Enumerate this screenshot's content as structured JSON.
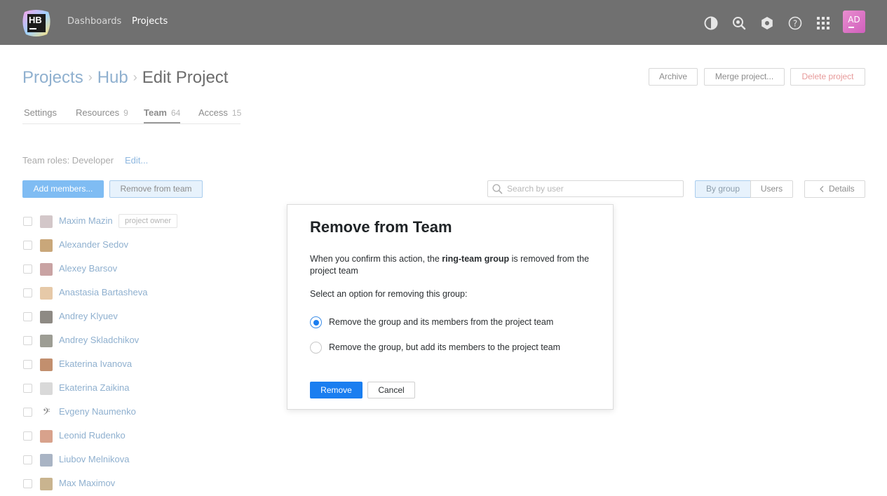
{
  "header": {
    "logo_text": "HB",
    "nav": [
      "Dashboards",
      "Projects"
    ],
    "active_nav": "Projects",
    "avatar_initials": "AD",
    "icons": [
      "contrast-icon",
      "search-icon",
      "settings-icon",
      "help-icon",
      "apps-grid-icon"
    ]
  },
  "breadcrumb": {
    "items": [
      "Projects",
      "Hub"
    ],
    "current": "Edit Project"
  },
  "actions": {
    "archive": "Archive",
    "merge": "Merge project...",
    "delete": "Delete project"
  },
  "tabs": [
    {
      "label": "Settings",
      "count": ""
    },
    {
      "label": "Resources",
      "count": "9"
    },
    {
      "label": "Team",
      "count": "64"
    },
    {
      "label": "Access",
      "count": "15"
    }
  ],
  "team": {
    "roles_label": "Team roles: Developer",
    "edit_label": "Edit...",
    "add_members": "Add members...",
    "remove_from_team": "Remove from team",
    "search_placeholder": "Search by user",
    "view_by_group": "By group",
    "view_users": "Users",
    "details": "Details"
  },
  "members": [
    {
      "name": "Maxim Mazin",
      "badge": "project owner"
    },
    {
      "name": "Alexander Sedov"
    },
    {
      "name": "Alexey Barsov"
    },
    {
      "name": "Anastasia Bartasheva"
    },
    {
      "name": "Andrey Klyuev"
    },
    {
      "name": "Andrey Skladchikov"
    },
    {
      "name": "Ekaterina Ivanova"
    },
    {
      "name": "Ekaterina Zaikina"
    },
    {
      "name": "Evgeny Naumenko"
    },
    {
      "name": "Leonid Rudenko"
    },
    {
      "name": "Liubov Melnikova"
    },
    {
      "name": "Max Maximov"
    }
  ],
  "modal": {
    "title": "Remove from Team",
    "msg_before": "When you confirm this action, the ",
    "msg_bold": "ring-team group",
    "msg_after": " is removed from the project team",
    "prompt": "Select an option for removing this group:",
    "options": [
      "Remove the group and its members from the project team",
      "Remove the group, but add its members to the project team"
    ],
    "selected_option": 0,
    "remove": "Remove",
    "cancel": "Cancel"
  },
  "colors": {
    "header_bg": "#707070",
    "primary": "#1a7ef0",
    "link": "#8fb0cf",
    "danger": "#e79a9a"
  }
}
